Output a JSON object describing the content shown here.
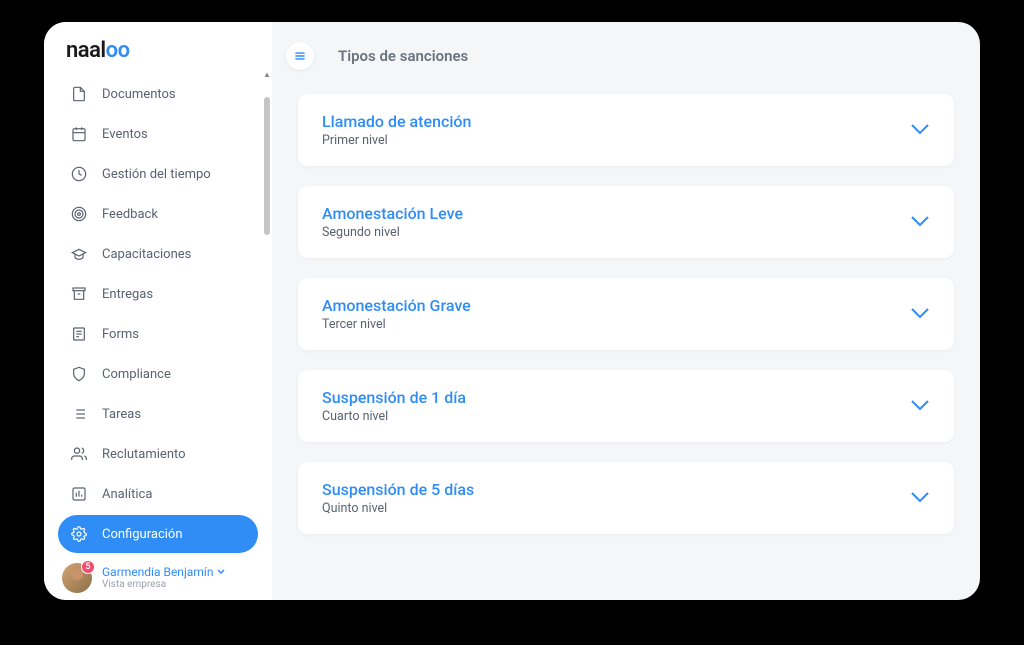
{
  "logo": {
    "part1": "naal",
    "part2": "oo"
  },
  "page": {
    "title": "Tipos de sanciones"
  },
  "sidebar": {
    "items": [
      {
        "label": "Documentos",
        "icon": "document-icon"
      },
      {
        "label": "Eventos",
        "icon": "calendar-icon"
      },
      {
        "label": "Gestión del tiempo",
        "icon": "clock-icon"
      },
      {
        "label": "Feedback",
        "icon": "target-icon"
      },
      {
        "label": "Capacitaciones",
        "icon": "graduation-icon"
      },
      {
        "label": "Entregas",
        "icon": "archive-icon"
      },
      {
        "label": "Forms",
        "icon": "form-icon"
      },
      {
        "label": "Compliance",
        "icon": "shield-icon"
      },
      {
        "label": "Tareas",
        "icon": "tasks-icon"
      },
      {
        "label": "Reclutamiento",
        "icon": "people-icon"
      },
      {
        "label": "Analítica",
        "icon": "analytics-icon"
      },
      {
        "label": "Configuración",
        "icon": "gear-icon",
        "active": true
      }
    ]
  },
  "user": {
    "name": "Garmendia Benjamín",
    "subtitle": "Vista empresa",
    "badge": "5"
  },
  "sanctions": [
    {
      "title": "Llamado de atención",
      "level": "Primer nivel"
    },
    {
      "title": "Amonestación Leve",
      "level": "Segundo nivel"
    },
    {
      "title": "Amonestación Grave",
      "level": "Tercer nivel"
    },
    {
      "title": "Suspensión de 1 día",
      "level": "Cuarto nivel"
    },
    {
      "title": "Suspensión de 5 días",
      "level": "Quinto nivel"
    }
  ]
}
